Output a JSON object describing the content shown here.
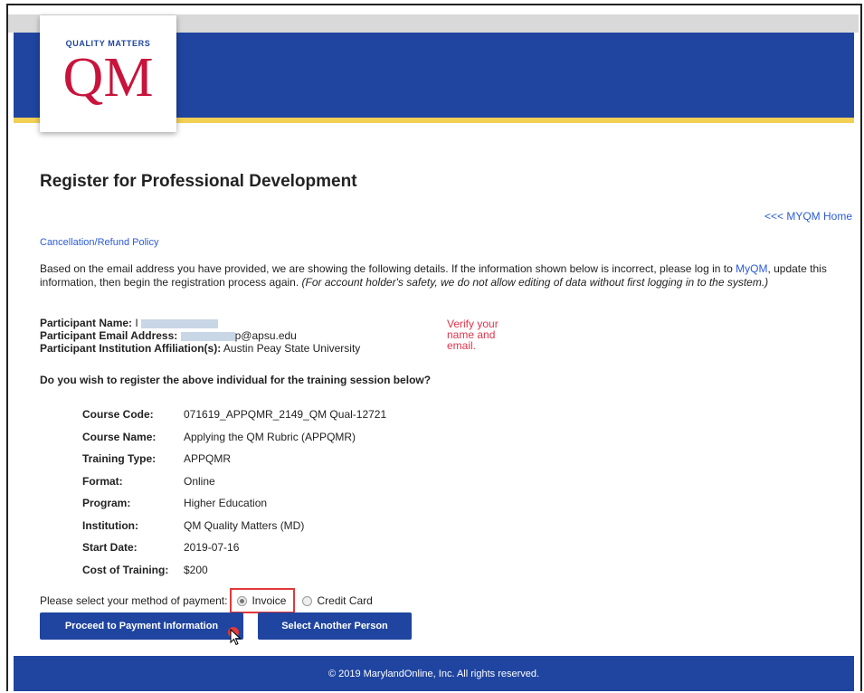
{
  "branding": {
    "logo_tagline": "QUALITY MATTERS",
    "logo_letters": "QM",
    "colors": {
      "primary": "#1f45a0",
      "accent_gold": "#f2cf55",
      "logo_red": "#c8143c",
      "link": "#2b5bd6"
    }
  },
  "header": {
    "title": "Register for Professional Development",
    "home_link": "<<< MYQM Home",
    "cancellation_link": "Cancellation/Refund Policy"
  },
  "intro": {
    "text_start": "Based on the email address you have provided, we are showing the following details. If the information shown below is incorrect, please log in to ",
    "myqm_link": "MyQM",
    "text_mid": ", update this information, then begin the registration process again. ",
    "text_italic": "(For account holder's safety, we do not allow editing of data without first logging in to the system.)"
  },
  "participant": {
    "name_label": "Participant Name:",
    "name_prefix": "I",
    "email_label": "Participant Email Address:",
    "email_suffix": "p@apsu.edu",
    "affiliation_label": "Participant Institution Affiliation(s):",
    "affiliation_value": "Austin Peay State University"
  },
  "annotation": {
    "verify_text": "Verify your name and email."
  },
  "question": "Do you wish to register the above individual for the training session below?",
  "course": {
    "rows": [
      {
        "label": "Course Code:",
        "value": "071619_APPQMR_2149_QM Qual-12721"
      },
      {
        "label": "Course Name:",
        "value": "Applying the QM Rubric (APPQMR)"
      },
      {
        "label": "Training Type:",
        "value": "APPQMR"
      },
      {
        "label": "Format:",
        "value": "Online"
      },
      {
        "label": "Program:",
        "value": "Higher Education"
      },
      {
        "label": "Institution:",
        "value": "QM Quality Matters (MD)"
      },
      {
        "label": "Start Date:",
        "value": "2019-07-16"
      },
      {
        "label": "Cost of Training:",
        "value": "$200"
      }
    ]
  },
  "payment": {
    "prompt": "Please select your method of payment:",
    "options": [
      "Invoice",
      "Credit Card"
    ],
    "selected": "Invoice"
  },
  "buttons": {
    "proceed": "Proceed to Payment Information",
    "select_another": "Select Another Person"
  },
  "footer": {
    "copyright": "© 2019 MarylandOnline, Inc. All rights reserved."
  }
}
